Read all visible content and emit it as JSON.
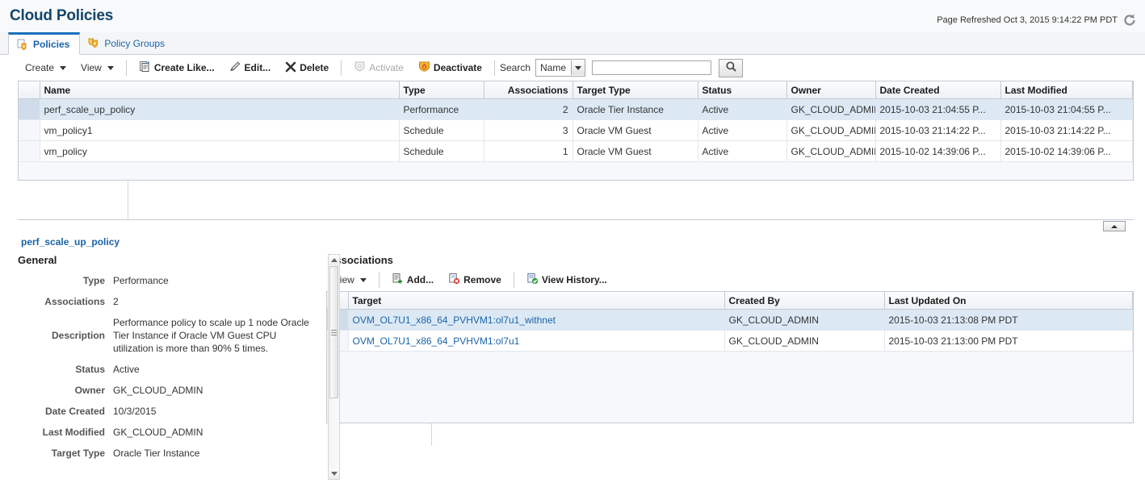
{
  "header": {
    "title": "Cloud Policies",
    "refresh_label": "Page Refreshed Oct 3, 2015 9:14:22 PM PDT",
    "refresh_icon": "refresh-icon"
  },
  "tabs": [
    {
      "label": "Policies",
      "icon": "policy-shield-icon",
      "active": true
    },
    {
      "label": "Policy Groups",
      "icon": "policy-group-shield-icon",
      "active": false
    }
  ],
  "toolbar": {
    "create_label": "Create",
    "view_label": "View",
    "create_like_label": "Create Like...",
    "edit_label": "Edit...",
    "delete_label": "Delete",
    "activate_label": "Activate",
    "deactivate_label": "Deactivate",
    "search_label": "Search",
    "search_field_selected": "Name",
    "search_value": "",
    "search_placeholder": "",
    "search_button_icon": "search-icon"
  },
  "policies_table": {
    "columns": [
      "Name",
      "Type",
      "Associations",
      "Target Type",
      "Status",
      "Owner",
      "Date Created",
      "Last Modified"
    ],
    "rows": [
      {
        "name": "perf_scale_up_policy",
        "type": "Performance",
        "associations": "2",
        "target_type": "Oracle Tier Instance",
        "status": "Active",
        "owner": "GK_CLOUD_ADMIN",
        "date_created": "2015-10-03 21:04:55 P...",
        "last_modified": "2015-10-03 21:04:55 P...",
        "selected": true
      },
      {
        "name": "vm_policy1",
        "type": "Schedule",
        "associations": "3",
        "target_type": "Oracle VM Guest",
        "status": "Active",
        "owner": "GK_CLOUD_ADMIN",
        "date_created": "2015-10-03 21:14:22 P...",
        "last_modified": "2015-10-03 21:14:22 P...",
        "selected": false
      },
      {
        "name": "vm_policy",
        "type": "Schedule",
        "associations": "1",
        "target_type": "Oracle VM Guest",
        "status": "Active",
        "owner": "GK_CLOUD_ADMIN",
        "date_created": "2015-10-02 14:39:06 P...",
        "last_modified": "2015-10-02 14:39:06 P...",
        "selected": false
      }
    ]
  },
  "detail": {
    "policy_name": "perf_scale_up_policy",
    "general_heading": "General",
    "fields": [
      {
        "label": "Type",
        "value": "Performance"
      },
      {
        "label": "Associations",
        "value": "2"
      },
      {
        "label": "Description",
        "value": "Performance policy to scale up 1 node Oracle Tier Instance if Oracle VM Guest CPU utilization is more than 90% 5 times."
      },
      {
        "label": "Status",
        "value": "Active"
      },
      {
        "label": "Owner",
        "value": "GK_CLOUD_ADMIN"
      },
      {
        "label": "Date Created",
        "value": "10/3/2015"
      },
      {
        "label": "Last Modified",
        "value": "GK_CLOUD_ADMIN"
      },
      {
        "label": "Target Type",
        "value": "Oracle Tier Instance"
      }
    ]
  },
  "associations": {
    "heading": "Associations",
    "toolbar": {
      "view_label": "View",
      "add_label": "Add...",
      "remove_label": "Remove",
      "view_history_label": "View History..."
    },
    "columns": [
      "Target",
      "Created By",
      "Last Updated On"
    ],
    "rows": [
      {
        "target": "OVM_OL7U1_x86_64_PVHVM1:ol7u1_withnet",
        "created_by": "GK_CLOUD_ADMIN",
        "last_updated_on": "2015-10-03 21:13:08 PM PDT",
        "selected": true
      },
      {
        "target": "OVM_OL7U1_x86_64_PVHVM1:ol7u1",
        "created_by": "GK_CLOUD_ADMIN",
        "last_updated_on": "2015-10-03 21:13:00 PM PDT",
        "selected": false
      }
    ]
  },
  "colors": {
    "title": "#13456b",
    "link": "#1b63a8",
    "selection": "#dce9f5",
    "header_bg": "#f4f5f7",
    "grid_border": "#c5cbd3",
    "tab_accent": "#1a6fba"
  }
}
